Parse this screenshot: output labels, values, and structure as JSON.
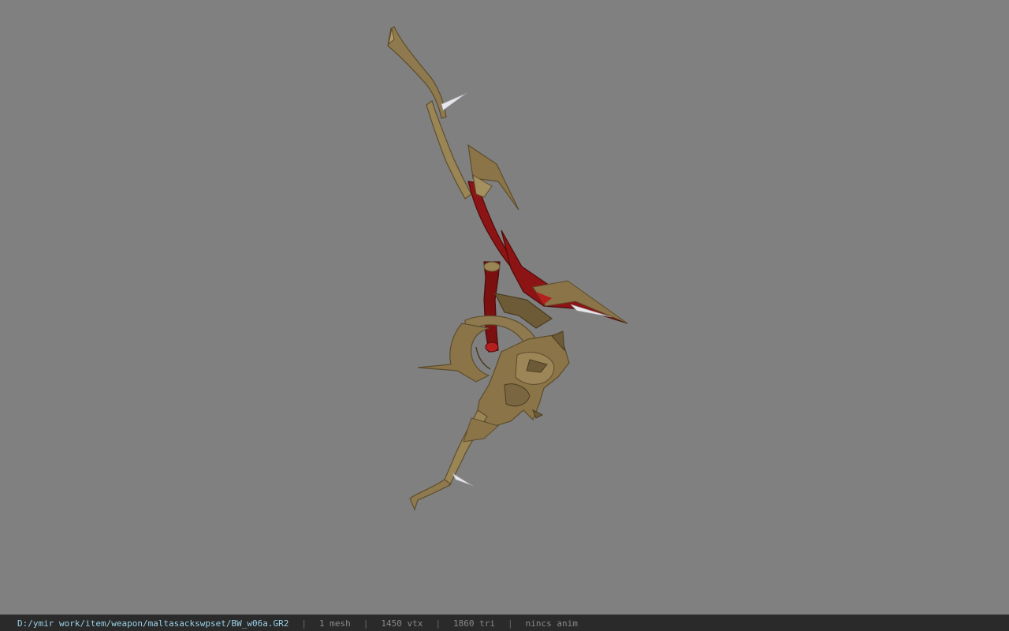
{
  "viewport": {
    "background_color": "#808080",
    "model_name": "bow-model"
  },
  "colors": {
    "bow_tan": "#8f7a4f",
    "bow_tan_dark": "#5d4d2d",
    "bow_tan_light": "#b19a66",
    "bow_red": "#8c1414",
    "bow_red_dark": "#4e0a0a",
    "spike_white": "#e8e8ec"
  },
  "statusbar": {
    "path": "D:/ymir work/item/weapon/maltasackswpset/BW_w06a.GR2",
    "separator": "|",
    "mesh_count": "1 mesh",
    "vertex_count": "1450 vtx",
    "triangle_count": "1860 tri",
    "anim": "nincs anim"
  }
}
